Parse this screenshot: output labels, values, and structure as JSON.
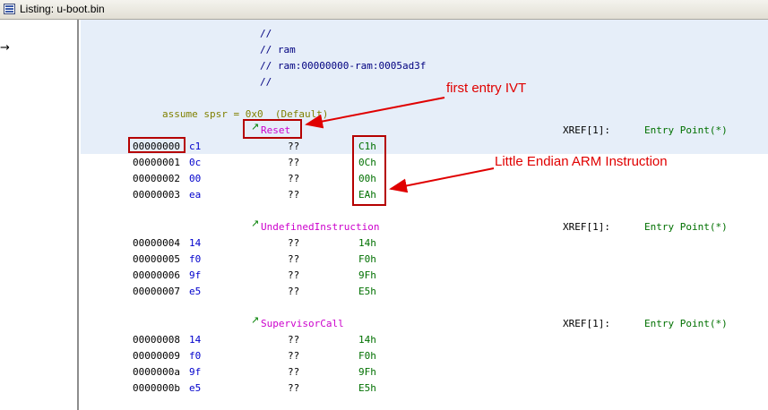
{
  "window": {
    "title": "Listing:  u-boot.bin",
    "cursor_glyph": "→"
  },
  "header_comments": [
    "//",
    "// ram",
    "// ram:00000000-ram:0005ad3f",
    "//"
  ],
  "assume_line": "assume spsr = 0x0  (Default)",
  "sections": [
    {
      "label": "Reset",
      "xref": "XREF[1]:",
      "xref_target": "Entry Point(*)",
      "rows": [
        {
          "addr": "00000000",
          "byte": "c1",
          "mnem": "??",
          "val": "C1h"
        },
        {
          "addr": "00000001",
          "byte": "0c",
          "mnem": "??",
          "val": "0Ch"
        },
        {
          "addr": "00000002",
          "byte": "00",
          "mnem": "??",
          "val": "00h"
        },
        {
          "addr": "00000003",
          "byte": "ea",
          "mnem": "??",
          "val": "EAh"
        }
      ]
    },
    {
      "label": "UndefinedInstruction",
      "xref": "XREF[1]:",
      "xref_target": "Entry Point(*)",
      "rows": [
        {
          "addr": "00000004",
          "byte": "14",
          "mnem": "??",
          "val": "14h"
        },
        {
          "addr": "00000005",
          "byte": "f0",
          "mnem": "??",
          "val": "F0h"
        },
        {
          "addr": "00000006",
          "byte": "9f",
          "mnem": "??",
          "val": "9Fh"
        },
        {
          "addr": "00000007",
          "byte": "e5",
          "mnem": "??",
          "val": "E5h"
        }
      ]
    },
    {
      "label": "SupervisorCall",
      "xref": "XREF[1]:",
      "xref_target": "Entry Point(*)",
      "rows": [
        {
          "addr": "00000008",
          "byte": "14",
          "mnem": "??",
          "val": "14h"
        },
        {
          "addr": "00000009",
          "byte": "f0",
          "mnem": "??",
          "val": "F0h"
        },
        {
          "addr": "0000000a",
          "byte": "9f",
          "mnem": "??",
          "val": "9Fh"
        },
        {
          "addr": "0000000b",
          "byte": "e5",
          "mnem": "??",
          "val": "E5h"
        }
      ]
    }
  ],
  "annotations": {
    "first_entry": "first entry IVT",
    "little_endian": "Little Endian ARM Instruction",
    "color": "#e00000",
    "box_color": "#b50000"
  },
  "colors": {
    "highlight_bg": "#e6eef9",
    "label": "#cc00cc",
    "bytes": "#0000cc",
    "values": "#007000",
    "comment": "#000080",
    "assume": "#808000"
  },
  "icons": {
    "window_icon": "listing-window-icon",
    "xref_arrow": "xref-arrow-icon"
  }
}
